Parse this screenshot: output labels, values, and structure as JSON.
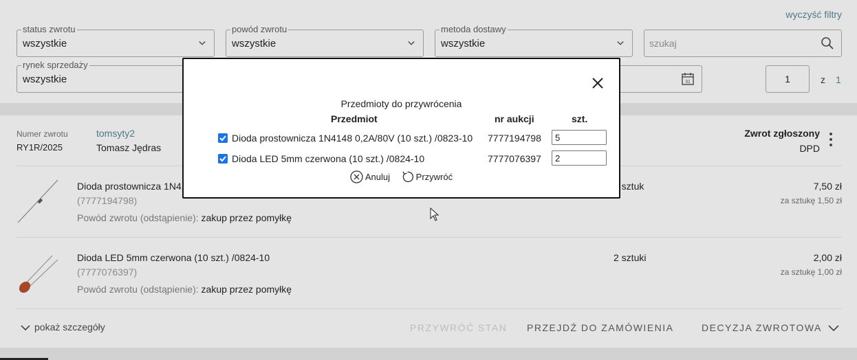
{
  "filters": {
    "clear_label": "wyczyść filtry",
    "status": {
      "label": "status zwrotu",
      "value": "wszystkie"
    },
    "reason": {
      "label": "powód zwrotu",
      "value": "wszystkie"
    },
    "delivery": {
      "label": "metoda dostawy",
      "value": "wszystkie"
    },
    "market": {
      "label": "rynek sprzedaży",
      "value": "wszystkie"
    },
    "search_placeholder": "szukaj",
    "page_current": "1",
    "page_of": "z",
    "page_total": "1"
  },
  "return": {
    "number_label": "Numer zwrotu",
    "number": "RY1R/2025",
    "buyer_login": "tomsyty2",
    "buyer_name": "Tomasz Jędras",
    "status": "Zwrot zgłoszony",
    "carrier": "DPD",
    "items": [
      {
        "name": "Dioda prostownicza 1N4148 0,2A/80V (10 szt.) /0823-10",
        "auction": "(7777194798)",
        "reason_label": "Powód zwrotu (odstąpienie):",
        "reason": "zakup przez pomyłkę",
        "qty": "5 sztuk",
        "price": "7,50 zł",
        "unit_price": "za sztukę 1,50 zł"
      },
      {
        "name": "Dioda LED 5mm czerwona (10 szt.) /0824-10",
        "auction": "(7777076397)",
        "reason_label": "Powód zwrotu (odstąpienie):",
        "reason": "zakup przez pomyłkę",
        "qty": "2 sztuki",
        "price": "2,00 zł",
        "unit_price": "za sztukę 1,00 zł"
      }
    ],
    "show_details": "pokaż szczegóły",
    "restore_state": "PRZYWRÓĆ STAN",
    "go_to_order": "PRZEJDŹ DO ZAMÓWIENIA",
    "decision": "DECYZJA ZWROTOWA"
  },
  "modal": {
    "title": "Przedmioty do przywrócenia",
    "col_item": "Przedmiot",
    "col_auction": "nr aukcji",
    "col_qty": "szt.",
    "rows": [
      {
        "name": "Dioda prostownicza 1N4148 0,2A/80V (10 szt.) /0823-10",
        "auction": "7777194798",
        "qty": "5",
        "checked": true
      },
      {
        "name": "Dioda LED 5mm czerwona (10 szt.) /0824-10",
        "auction": "7777076397",
        "qty": "2",
        "checked": true
      }
    ],
    "cancel_label": "Anuluj",
    "restore_label": "Przywróć"
  },
  "colors": {
    "accent": "#4a7a85",
    "checkbox": "#1a73e8",
    "background": "#e4e4e4"
  }
}
